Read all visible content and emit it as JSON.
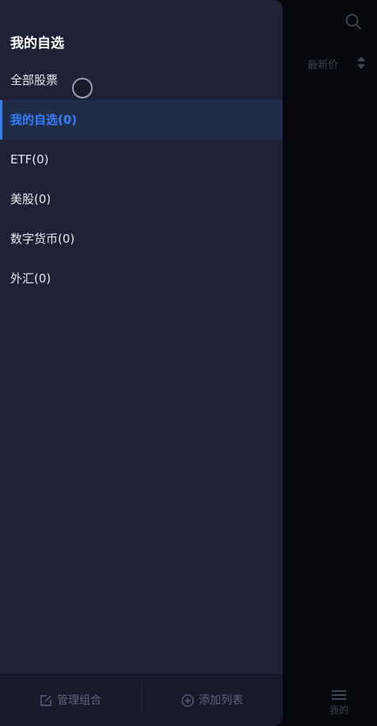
{
  "background": {
    "sort_label": "最新价",
    "tab_label": "我的"
  },
  "drawer": {
    "title": "我的自选",
    "items": [
      {
        "label": "全部股票",
        "active": false
      },
      {
        "label": "我的自选(0)",
        "active": true
      },
      {
        "label": "ETF(0)",
        "active": false
      },
      {
        "label": "美股(0)",
        "active": false
      },
      {
        "label": "数字货币(0)",
        "active": false
      },
      {
        "label": "外汇(0)",
        "active": false
      }
    ],
    "footer": {
      "manage_label": "管理组合",
      "add_label": "添加列表"
    }
  },
  "colors": {
    "accent": "#2f80ff",
    "drawer_bg": "#1f2136",
    "active_bg": "#212c48"
  },
  "icons": {
    "search": "search-icon",
    "sort": "sort-icon",
    "menu": "menu-icon",
    "edit": "edit-icon",
    "add": "plus-circle-icon"
  }
}
